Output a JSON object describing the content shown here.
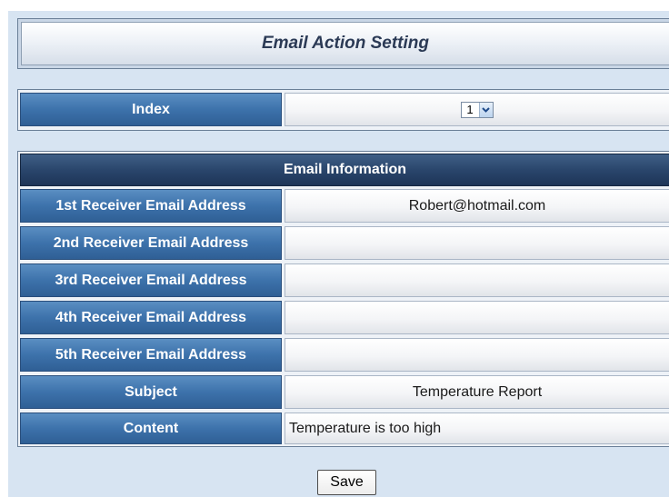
{
  "title": "Email Action Setting",
  "index": {
    "label": "Index",
    "selected": "1"
  },
  "email_info": {
    "header": "Email Information",
    "rows": [
      {
        "label": "1st Receiver Email Address",
        "value": "Robert@hotmail.com"
      },
      {
        "label": "2nd Receiver Email Address",
        "value": ""
      },
      {
        "label": "3rd Receiver Email Address",
        "value": ""
      },
      {
        "label": "4th Receiver Email Address",
        "value": ""
      },
      {
        "label": "5th Receiver Email Address",
        "value": ""
      },
      {
        "label": "Subject",
        "value": "Temperature Report"
      },
      {
        "label": "Content",
        "value": "Temperature is too high"
      }
    ]
  },
  "save_label": "Save",
  "icons": {
    "dropdown": "chevron-down-icon"
  }
}
